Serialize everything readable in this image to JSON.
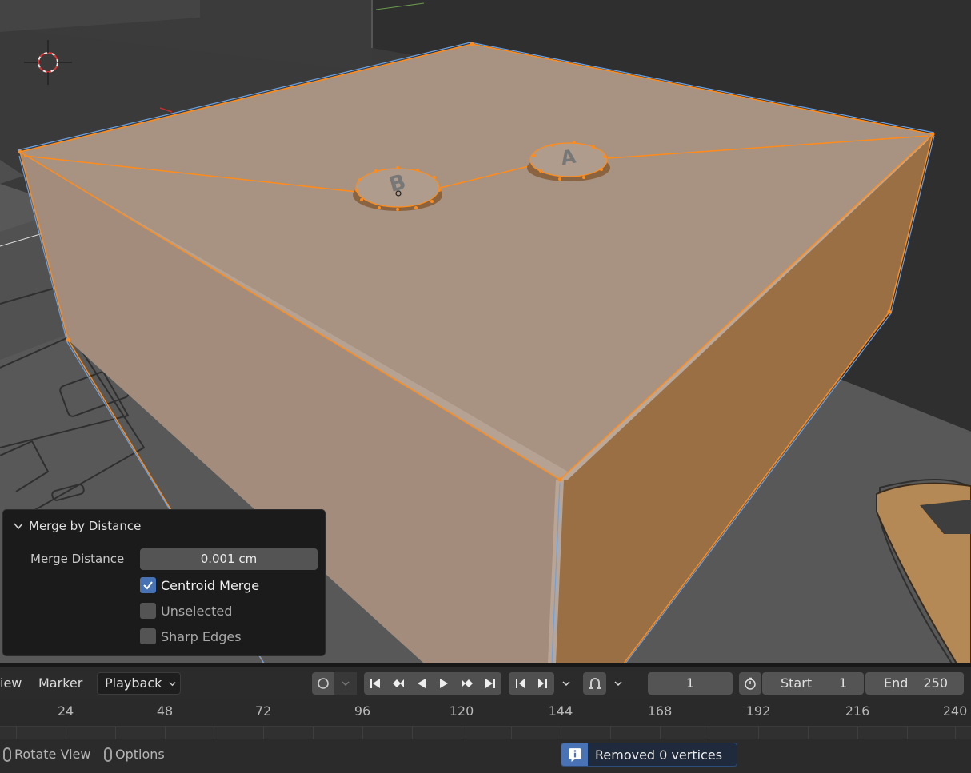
{
  "operator_panel": {
    "title": "Merge by Distance",
    "merge_distance_label": "Merge Distance",
    "merge_distance_value": "0.001 cm",
    "options": [
      {
        "label": "Centroid Merge",
        "checked": true
      },
      {
        "label": "Unselected",
        "checked": false
      },
      {
        "label": "Sharp Edges",
        "checked": false
      }
    ]
  },
  "timeline": {
    "menus": [
      "iew",
      "Marker"
    ],
    "playback_label": "Playback",
    "current_frame": "1",
    "start_label": "Start",
    "start_value": "1",
    "end_label": "End",
    "end_value": "250",
    "ruler_ticks": [
      "24",
      "48",
      "72",
      "96",
      "120",
      "144",
      "168",
      "192",
      "216",
      "240"
    ]
  },
  "status_bar": {
    "rotate_view_label": "Rotate View",
    "options_label": "Options",
    "report_message": "Removed 0 vertices"
  },
  "scene": {
    "object_color": "#a98f7c",
    "selection_color": "#ff8c1a",
    "edge_highlight_color": "#6aa2e6",
    "button_letters": [
      "B",
      "A"
    ]
  },
  "icons": {
    "collapse": "chevron-down-icon",
    "checkbox": "checkmark-icon",
    "report": "info-icon",
    "stopwatch": "stopwatch-icon",
    "snapping": "magnet-icon"
  }
}
